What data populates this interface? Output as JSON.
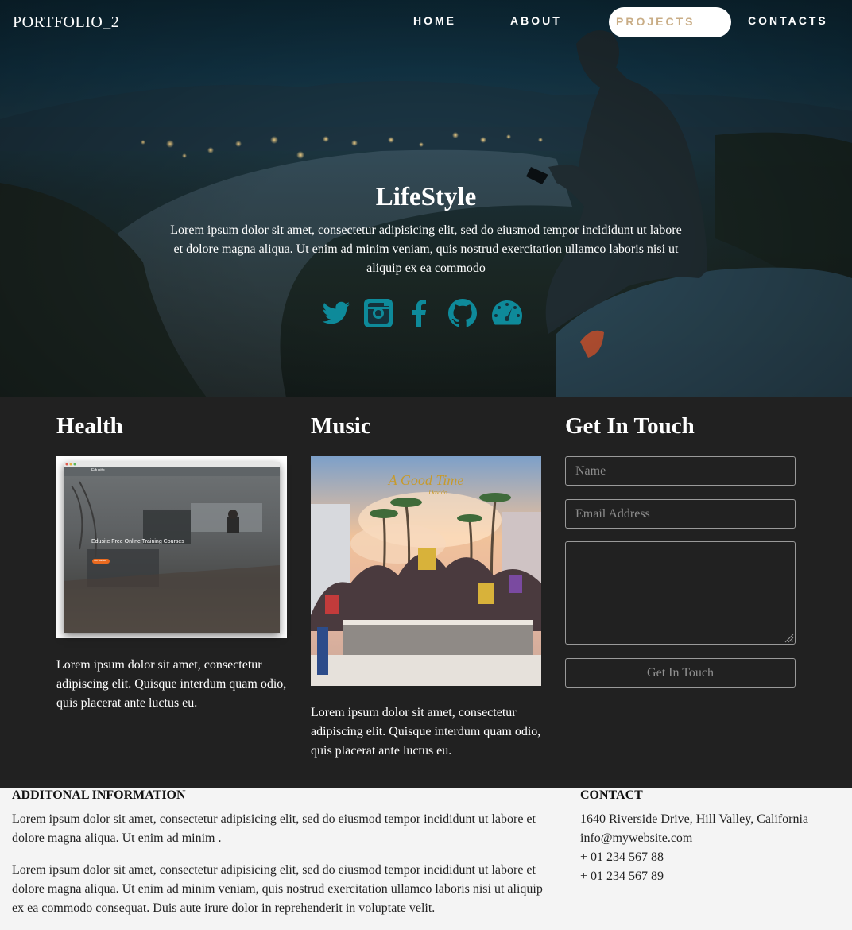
{
  "nav": {
    "brand": "PORTFOLIO_2",
    "items": [
      {
        "label": "HOME"
      },
      {
        "label": "ABOUT"
      },
      {
        "label": "PROJECTS",
        "active": true
      },
      {
        "label": "CONTACTS"
      }
    ],
    "active_text_color": "#c9ad86"
  },
  "hero": {
    "title": "LifeStyle",
    "text": "Lorem ipsum dolor sit amet, consectetur adipisicing elit, sed do eiusmod tempor incididunt ut labore et dolore magna aliqua. Ut enim ad minim veniam, quis nostrud exercitation ullamco laboris nisi ut aliquip ex ea commodo",
    "social_icon_color": "#0e8a9a",
    "socials": [
      {
        "icon": "twitter-icon"
      },
      {
        "icon": "instagram-icon"
      },
      {
        "icon": "facebook-icon"
      },
      {
        "icon": "github-icon"
      },
      {
        "icon": "dashboard-icon"
      }
    ]
  },
  "health": {
    "title": "Health",
    "screenshot": {
      "brand": "Edusite",
      "heading": "Edusite Free Online Training Courses",
      "button": "Get Started"
    },
    "text": "Lorem ipsum dolor sit amet, consectetur adipiscing elit. Quisque interdum quam odio, quis placerat ante luctus eu."
  },
  "music": {
    "title": "Music",
    "cover_title": "A Good Time",
    "cover_artist": "Davido",
    "text": "Lorem ipsum dolor sit amet, consectetur adipiscing elit. Quisque interdum quam odio, quis placerat ante luctus eu."
  },
  "contact_form": {
    "title": "Get In Touch",
    "name_placeholder": "Name",
    "email_placeholder": "Email Address",
    "message_placeholder": "",
    "submit_label": "Get In Touch"
  },
  "footer": {
    "info_heading": "ADDITONAL INFORMATION",
    "info_p1": "Lorem ipsum dolor sit amet, consectetur adipisicing elit, sed do eiusmod tempor incididunt ut labore et dolore magna aliqua. Ut enim ad minim .",
    "info_p2": "Lorem ipsum dolor sit amet, consectetur adipisicing elit, sed do eiusmod tempor incididunt ut labore et dolore magna aliqua. Ut enim ad minim veniam, quis nostrud exercitation ullamco laboris nisi ut aliquip ex ea commodo consequat. Duis aute irure dolor in reprehenderit in voluptate velit.",
    "contact_heading": "CONTACT",
    "address": "1640 Riverside Drive, Hill Valley, California",
    "email": "info@mywebsite.com",
    "phone1": "+ 01 234 567 88",
    "phone2": "+ 01 234 567 89"
  }
}
